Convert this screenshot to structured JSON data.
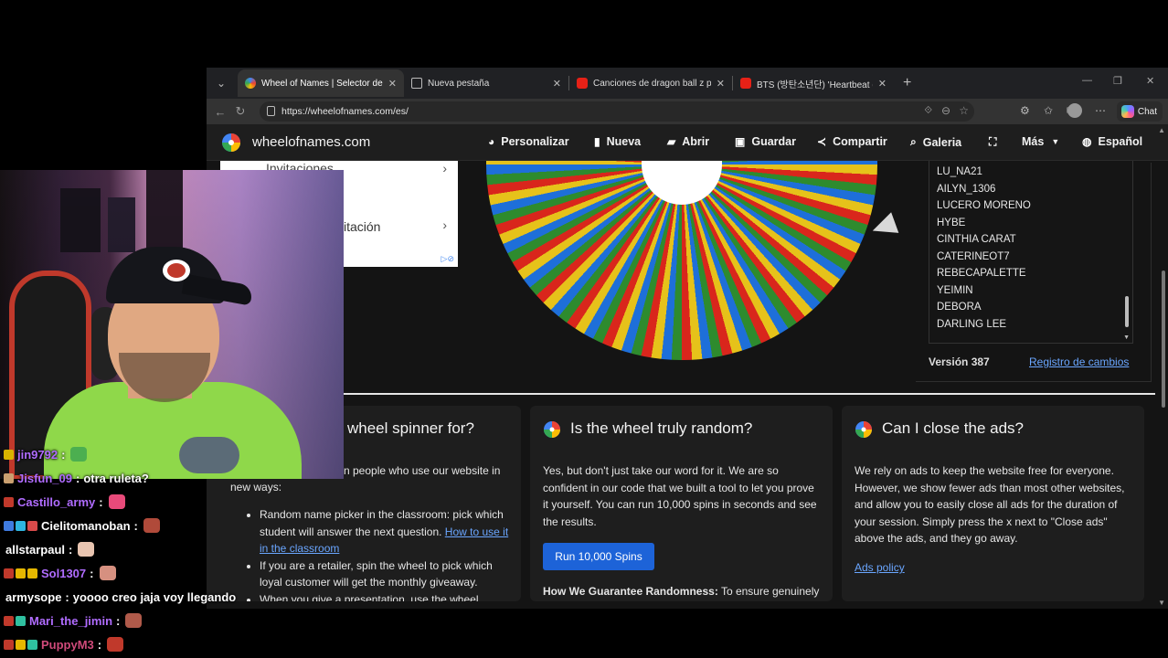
{
  "browser": {
    "tabs": [
      {
        "title": "Wheel of Names | Selector de nom",
        "active": true
      },
      {
        "title": "Nueva pestaña",
        "active": false
      },
      {
        "title": "Canciones de dragon ball z peleas",
        "active": false
      },
      {
        "title": "BTS (방탄소년단) 'Heartbeat (BTS W",
        "active": false
      }
    ],
    "url": "https://wheelofnames.com/es/",
    "chat_label": "Chat"
  },
  "site": {
    "brand": "wheelofnames.com",
    "menu": [
      "Personalizar",
      "Nueva",
      "Abrir",
      "Guardar",
      "Compartir",
      "Galeria",
      "Más",
      "Español"
    ],
    "names": [
      "LU_NA21",
      "AILYN_1306",
      "LUCERO MORENO",
      "HYBE",
      "CINTHIA CARAT",
      "CATERINEOT7",
      "REBECAPALETTE",
      "YEIMIN",
      "DEBORA",
      "DARLING LEE"
    ],
    "version": "Versión 387",
    "changelog": "Registro de cambios",
    "faq": {
      "card1": {
        "title": "wheel spinner for?",
        "intro_end": "n people who use our website in",
        "intro2": "new ways:",
        "bullet1_a": "Random name picker in the classroom: pick which student will answer the next question.",
        "bullet1_link": "How to use it in the classroom",
        "bullet2": "If you are a retailer, spin the wheel to pick which loyal customer will get the monthly giveaway.",
        "bullet3": "When you give a presentation, use the wheel"
      },
      "card2": {
        "title": "Is the wheel truly random?",
        "body": "Yes, but don't just take our word for it. We are so confident in our code that we built a tool to let you prove it yourself. You can run 10,000 spins in seconds and see the results.",
        "button": "Run 10,000 Spins",
        "guarantee_label": "How We Guarantee Randomness:",
        "guarantee_text": "To ensure genuinely unpredictable results, this site does not use the"
      },
      "card3": {
        "title": "Can I close the ads?",
        "body": "We rely on ads to keep the website free for everyone. However, we show fewer ads than most other websites, and allow you to easily close all ads for the duration of your session. Simply press the x next to \"Close ads\" above the ads, and they go away.",
        "link": "Ads policy"
      }
    }
  },
  "ad": {
    "row1": "Invitaciones",
    "row2": "itación"
  },
  "chat": [
    {
      "user": "jin9792",
      "color": "#b06cff",
      "msg": "",
      "badges": [
        "#d9b400"
      ],
      "emote": "#4caf50"
    },
    {
      "user": "Jisfun_09",
      "color": "#b06cff",
      "msg": "otra ruleta?",
      "badges": [
        "#caa070"
      ],
      "emote": ""
    },
    {
      "user": "Castillo_army",
      "color": "#b06cff",
      "msg": "",
      "badges": [
        "#c0392b"
      ],
      "emote": "#e84a7a"
    },
    {
      "user": "Cielitomanoban",
      "color": "#ffffff",
      "msg": "",
      "badges": [
        "#3f7be0",
        "#2fb5e0",
        "#d84a4a"
      ],
      "emote": "#b04a3a"
    },
    {
      "user": "allstarpaul",
      "color": "#ffffff",
      "msg": "",
      "badges": [],
      "emote": "#e8c4b0"
    },
    {
      "user": "Sol1307",
      "color": "#b06cff",
      "msg": "",
      "badges": [
        "#c0392b",
        "#e6b800",
        "#e6b800"
      ],
      "emote": "#d69080"
    },
    {
      "user": "armysope",
      "color": "#ffffff",
      "msg": "yoooo creo jaja voy llegando",
      "badges": [],
      "emote": ""
    },
    {
      "user": "Mari_the_jimin",
      "color": "#b06cff",
      "msg": "",
      "badges": [
        "#c0392b",
        "#2fc0a0"
      ],
      "emote": "#b05a4a"
    },
    {
      "user": "PuppyM3",
      "color": "#d04a7a",
      "msg": "",
      "badges": [
        "#c0392b",
        "#e6b800",
        "#2fc0a0"
      ],
      "emote": "#c0392b"
    }
  ],
  "colors": {
    "wheel_green": "#2e8b2e",
    "wheel_blue": "#1e6fd9",
    "wheel_yellow": "#e6c21a",
    "wheel_red": "#d9261c",
    "accent_blue": "#1d63d8",
    "link_blue": "#6aa6ff"
  }
}
